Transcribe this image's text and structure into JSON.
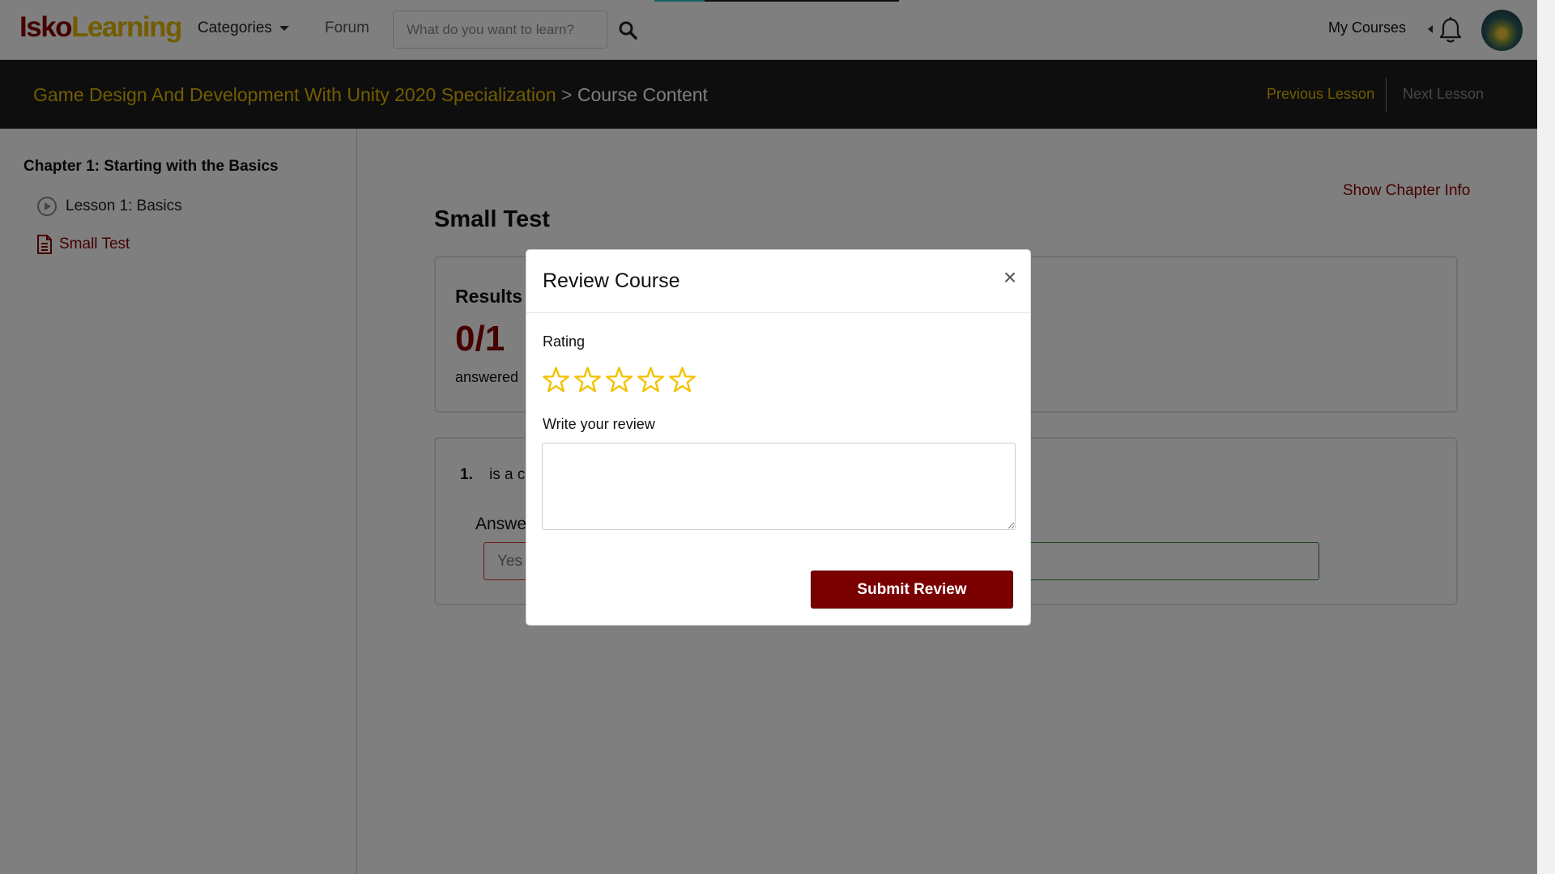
{
  "nav": {
    "logo_part1": "Isko",
    "logo_part2": "Learning",
    "categories": "Categories",
    "forum": "Forum",
    "search_placeholder": "What do you want to learn?",
    "my_courses": "My Courses"
  },
  "breadcrumb": {
    "course": "Game Design And Development With Unity 2020 Specialization",
    "separator": ">",
    "current": "Course Content",
    "previous_lesson": "Previous Lesson",
    "next_lesson": "Next Lesson"
  },
  "sidebar": {
    "chapter_title": "Chapter 1: Starting with the Basics",
    "items": [
      {
        "label": "Lesson 1: Basics",
        "icon": "play-circle-icon"
      },
      {
        "label": "Small Test",
        "icon": "document-icon",
        "active": true
      }
    ]
  },
  "main": {
    "show_chapter_info": "Show Chapter Info",
    "title": "Small Test",
    "results_label": "Results",
    "score": "0/1",
    "answered_label": "answered",
    "question_number": "1.",
    "question_text": "is a c",
    "answer_label": "Answe",
    "answer_value": "Yes"
  },
  "modal": {
    "title": "Review Course",
    "close_label": "×",
    "rating_label": "Rating",
    "rating_value": 0,
    "rating_max": 5,
    "review_label": "Write your review",
    "review_value": "",
    "submit_label": "Submit Review"
  },
  "colors": {
    "brand_red": "#8b0000",
    "brand_gold": "#e6b800",
    "star_gold": "#f2c200",
    "crumb_bar": "#1d1d1d"
  }
}
